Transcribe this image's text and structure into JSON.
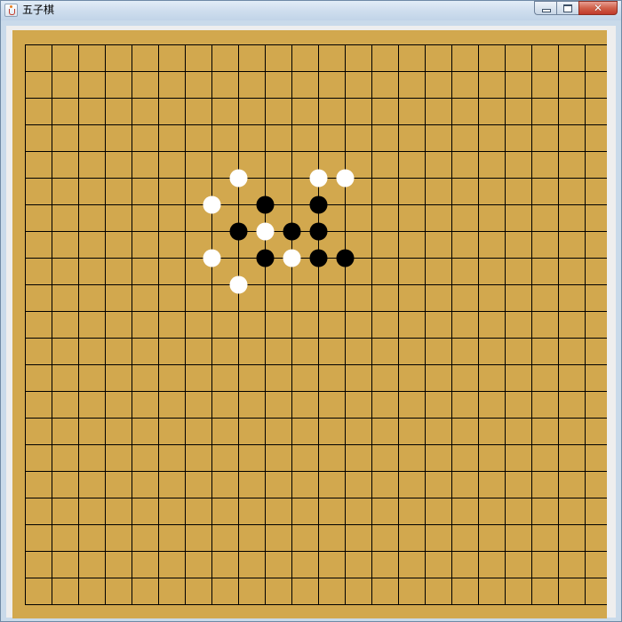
{
  "window": {
    "title": "五子棋",
    "close_glyph": "✕",
    "icons": {
      "app": "java-coffee-cup-icon",
      "minimize": "minimize-icon",
      "maximize": "maximize-icon",
      "close": "close-icon"
    }
  },
  "board": {
    "rows": 21,
    "cols": 22,
    "colors": {
      "board": "#d2a84e",
      "line": "#000000",
      "black": "#000000",
      "white": "#ffffff"
    },
    "stones": [
      {
        "color": "white",
        "col": 8,
        "row": 5
      },
      {
        "color": "white",
        "col": 11,
        "row": 5
      },
      {
        "color": "white",
        "col": 12,
        "row": 5
      },
      {
        "color": "white",
        "col": 7,
        "row": 6
      },
      {
        "color": "black",
        "col": 9,
        "row": 6
      },
      {
        "color": "black",
        "col": 11,
        "row": 6
      },
      {
        "color": "black",
        "col": 8,
        "row": 7
      },
      {
        "color": "white",
        "col": 9,
        "row": 7
      },
      {
        "color": "black",
        "col": 10,
        "row": 7
      },
      {
        "color": "black",
        "col": 11,
        "row": 7
      },
      {
        "color": "white",
        "col": 7,
        "row": 8
      },
      {
        "color": "black",
        "col": 9,
        "row": 8
      },
      {
        "color": "white",
        "col": 10,
        "row": 8
      },
      {
        "color": "black",
        "col": 11,
        "row": 8
      },
      {
        "color": "black",
        "col": 12,
        "row": 8
      },
      {
        "color": "white",
        "col": 8,
        "row": 9
      }
    ]
  }
}
